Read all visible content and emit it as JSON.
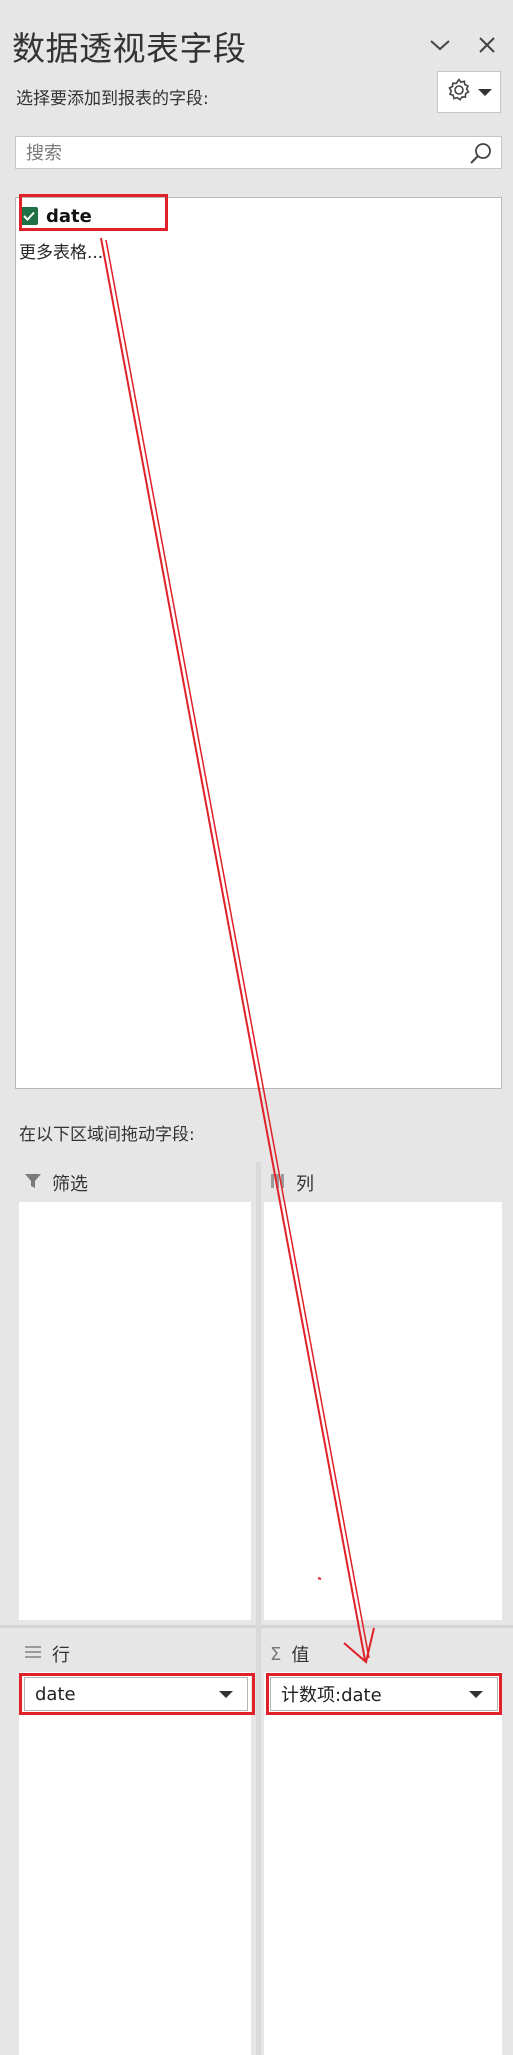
{
  "header": {
    "title": "数据透视表字段",
    "subtitle": "选择要添加到报表的字段:",
    "collapse_icon": "chevron-down-icon",
    "close_icon": "close-icon",
    "settings_icon": "gear-icon"
  },
  "search": {
    "placeholder": "搜索",
    "value": ""
  },
  "fields": {
    "items": [
      {
        "label": "date",
        "checked": true
      }
    ],
    "more_tables": "更多表格..."
  },
  "areas": {
    "hint": "在以下区域间拖动字段:",
    "filter": {
      "label": "筛选",
      "icon": "filter-icon"
    },
    "columns": {
      "label": "列",
      "icon": "columns-icon"
    },
    "rows": {
      "label": "行",
      "icon": "rows-icon",
      "item": "date"
    },
    "values": {
      "label": "值",
      "icon": "sigma-icon",
      "item": "计数项:date"
    }
  },
  "colors": {
    "panel_bg": "#e6e6e6",
    "checkbox_green": "#1e7145",
    "annotation_red": "#e0212a"
  }
}
